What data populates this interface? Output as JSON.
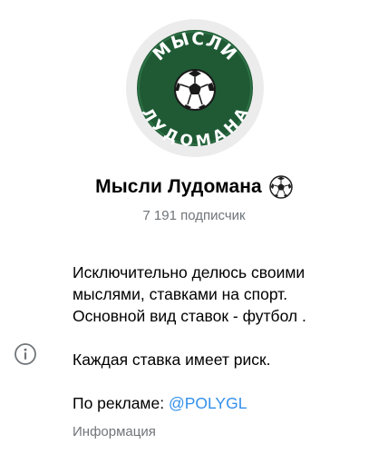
{
  "channel": {
    "title": "Мысли Лудомана",
    "title_emoji": "soccer-ball-icon",
    "subscribers": "7 191 подписчик"
  },
  "avatar": {
    "logo_text_top": "МЫСЛИ",
    "logo_text_bottom": "ЛУДОМАНА",
    "colors": {
      "ring": "#ececec",
      "badge": "#1f5a35"
    }
  },
  "description": {
    "line1": "Исключительно делюсь своими",
    "line2": "мыслями, ставками на спорт.",
    "line3": "Основной вид ставок - футбол .",
    "line4": "Каждая ставка имеет риск.",
    "ad_prefix": "По рекламе: ",
    "ad_link": "@POLYGL",
    "caption": "Информация"
  },
  "icons": {
    "info": "info-circle-icon"
  },
  "colors": {
    "link": "#3390ec",
    "secondary_text": "#707579"
  }
}
